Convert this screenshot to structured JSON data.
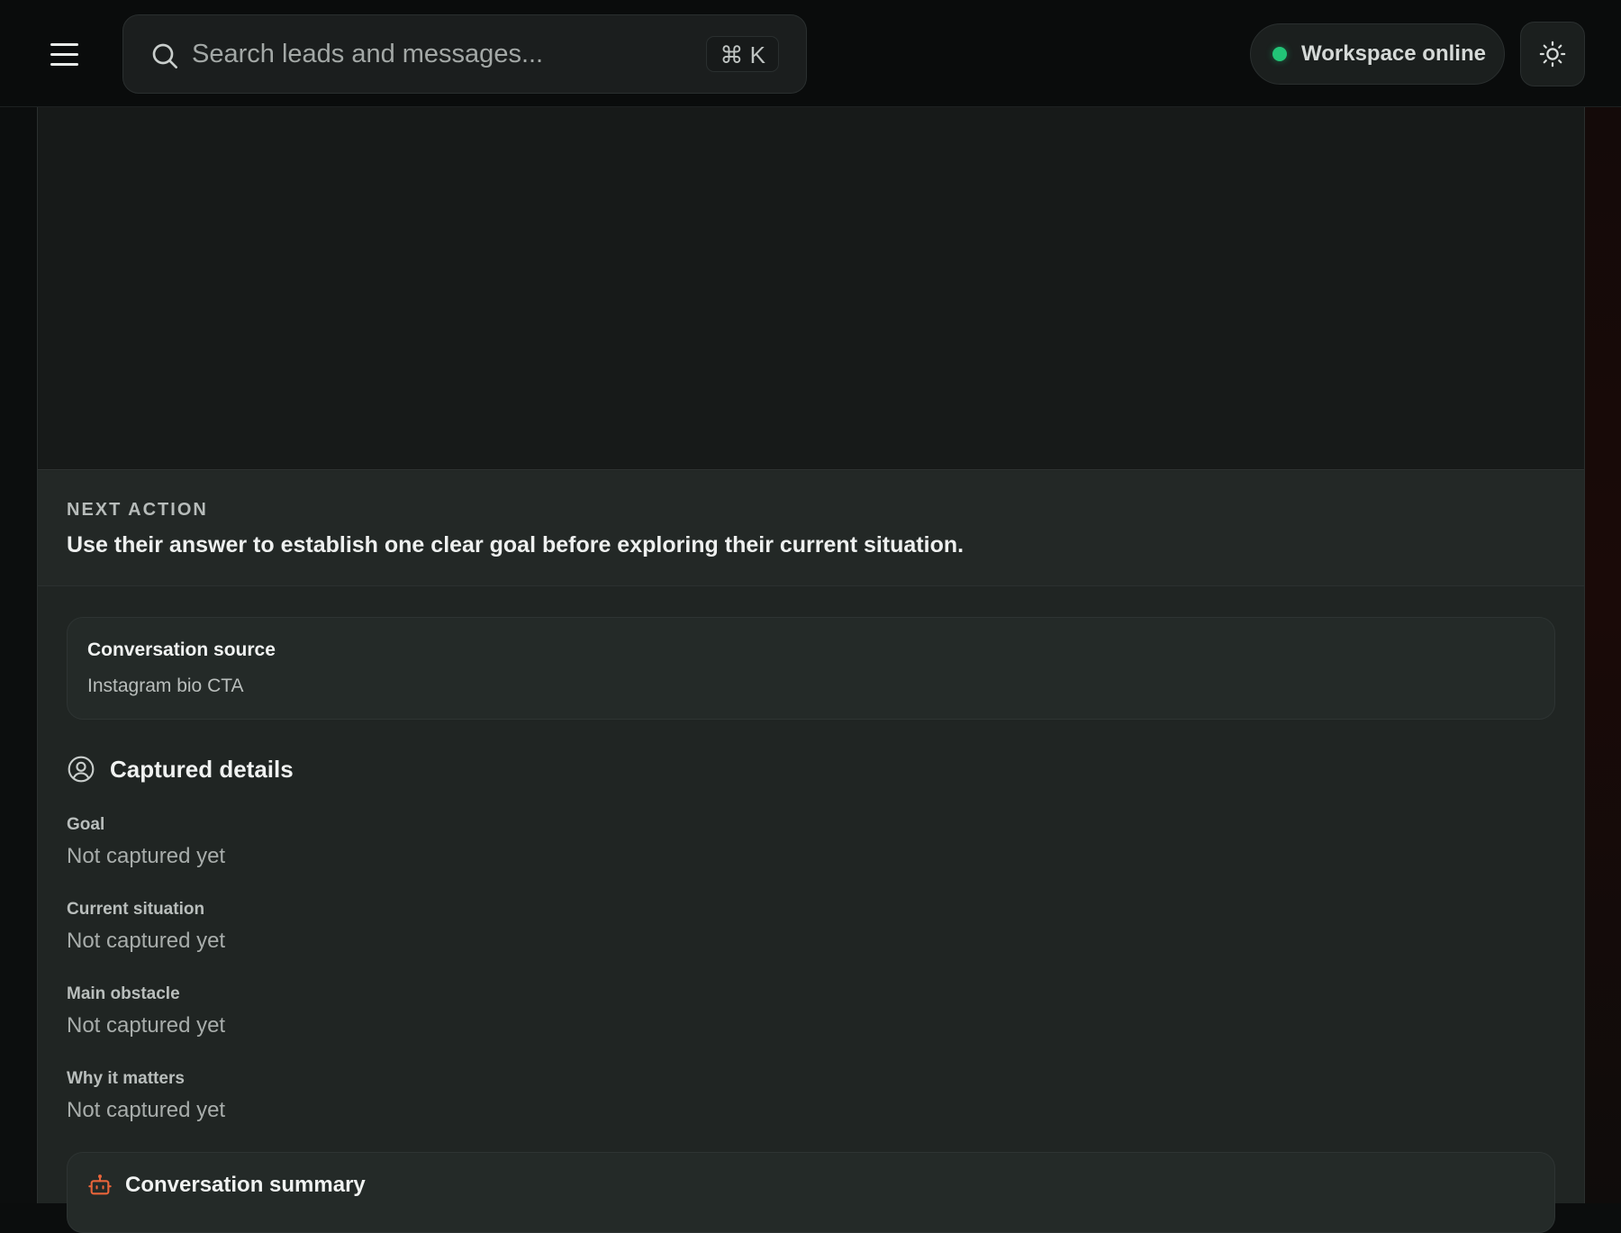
{
  "topbar": {
    "search": {
      "placeholder": "Search leads and messages...",
      "shortcut": "⌘ K"
    },
    "status": {
      "label": "Workspace online",
      "color": "#22c477"
    },
    "icons": {
      "menu": "menu-icon",
      "search": "search-icon",
      "theme": "sun-icon"
    }
  },
  "next_action": {
    "label": "NEXT ACTION",
    "text": "Use their answer to establish one clear goal before exploring their current situation."
  },
  "conversation_source": {
    "title": "Conversation source",
    "value": "Instagram bio CTA"
  },
  "captured_details": {
    "title": "Captured details",
    "icon": "user-circle-icon",
    "fields": [
      {
        "label": "Goal",
        "value": "Not captured yet"
      },
      {
        "label": "Current situation",
        "value": "Not captured yet"
      },
      {
        "label": "Main obstacle",
        "value": "Not captured yet"
      },
      {
        "label": "Why it matters",
        "value": "Not captured yet"
      }
    ]
  },
  "conversation_summary": {
    "title": "Conversation summary",
    "icon": "bot-icon",
    "icon_color": "#e8643a"
  }
}
